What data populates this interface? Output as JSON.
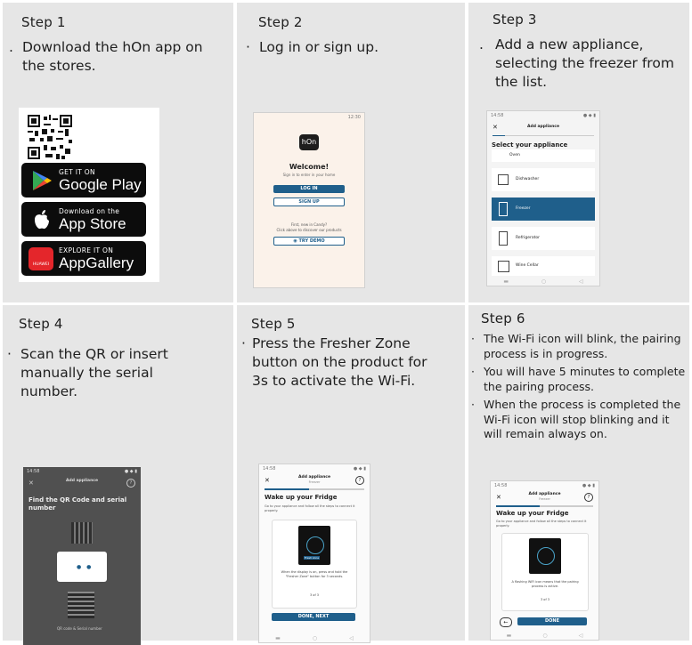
{
  "steps": [
    {
      "title": "Step 1",
      "bullets": [
        "Download the hOn app on the stores."
      ]
    },
    {
      "title": "Step 2",
      "bullets": [
        "Log in or sign up."
      ]
    },
    {
      "title": "Step 3",
      "bullets": [
        "Add a new appliance, selecting the freezer from the list."
      ]
    },
    {
      "title": "Step 4",
      "bullets": [
        "Scan the QR or insert manually the serial number."
      ]
    },
    {
      "title": "Step 5",
      "bullets": [
        "Press the Fresher Zone button on the product for 3s to activate the Wi-Fi."
      ]
    },
    {
      "title": "Step 6",
      "bullets": [
        "The Wi-Fi icon will blink, the pairing process is in progress.",
        "You will have 5 minutes to complete the pairing process.",
        "When the process is completed the Wi-Fi icon will stop blinking and it will remain always on."
      ]
    }
  ],
  "badges": {
    "google": {
      "small": "GET IT ON",
      "large": "Google Play"
    },
    "apple": {
      "small": "Download on the",
      "large": "App Store"
    },
    "huawei": {
      "small": "EXPLORE IT ON",
      "large": "AppGallery",
      "brand": "HUAWEI"
    }
  },
  "screen2": {
    "time": "12:30",
    "logo": "hOn",
    "welcome": "Welcome!",
    "subtitle": "Sign in to enter in your home",
    "login": "LOG IN",
    "signup": "SIGN UP",
    "first": "First, new in Candy?",
    "click": "Click above to discover our products",
    "try": "TRY DEMO"
  },
  "screen3": {
    "time": "14:58",
    "header": "Add appliance",
    "title": "Select your appliance",
    "items": [
      "Oven",
      "Dishwasher",
      "Freezer",
      "Refrigerator",
      "Wine Cellar"
    ]
  },
  "screen4": {
    "time": "14:58",
    "header": "Add appliance",
    "sub": "Freezer",
    "title": "Find the QR Code and serial number",
    "hint": "QR code & Serial number"
  },
  "screen5": {
    "time": "14:58",
    "header": "Add appliance",
    "sub": "Freezer",
    "title": "Wake up your Fridge",
    "desc": "Go to your appliance and follow all the steps to connect it properly.",
    "card": "When the display is on, press and hold the \"Fresher Zone\" button for 3 seconds.",
    "page": "3 of 3",
    "button": "DONE, NEXT",
    "chip": "Fresh zone"
  },
  "screen6": {
    "time": "14:58",
    "header": "Add appliance",
    "sub": "Freezer",
    "title": "Wake up your Fridge",
    "desc": "Go to your appliance and follow all the steps to connect it properly.",
    "card": "A flashing WiFi icon means that the pairing process is active.",
    "page": "3 of 3",
    "button": "DONE"
  },
  "colors": {
    "panel": "#e6e6e6",
    "accent": "#1f5f8b",
    "google_green": "#34a853",
    "huawei_red": "#e4262b"
  }
}
